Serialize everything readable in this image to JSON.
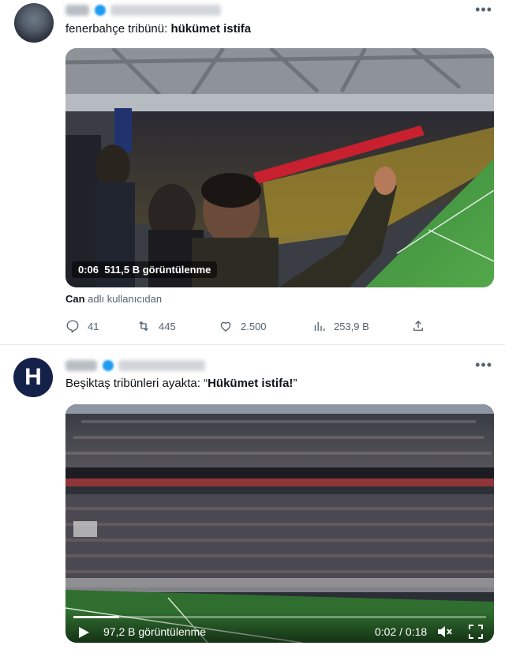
{
  "tweets": [
    {
      "text_prefix": "fenerbahçe tribünü: ",
      "text_bold": "hükümet istifa",
      "video": {
        "elapsed": "0:06",
        "views": "511,5 B görüntülenme"
      },
      "source": {
        "name": "Can",
        "suffix": " adlı kullanıcıdan"
      },
      "actions": {
        "replies": "41",
        "retweets": "445",
        "likes": "2.500",
        "views": "253,9 B"
      }
    },
    {
      "avatar_letter": "H",
      "text_prefix": "Beşiktaş tribünleri ayakta: “",
      "text_bold": "Hükümet istifa!",
      "text_suffix": "”",
      "video": {
        "views": "97,2 B görüntülenme",
        "time": "0:02 / 0:18",
        "progress": 0.11
      }
    }
  ],
  "icons": {
    "more": "more-horizontal-icon",
    "reply": "reply-icon",
    "retweet": "retweet-icon",
    "like": "heart-icon",
    "analytics": "bar-chart-icon",
    "share": "share-icon",
    "play": "play-icon",
    "volume": "volume-muted-icon",
    "fullscreen": "fullscreen-icon",
    "verified": "verified-badge-icon"
  },
  "colors": {
    "text": "#0f1419",
    "secondary": "#536471",
    "verified": "#1d9bf0",
    "divider": "#e6e9ea"
  }
}
